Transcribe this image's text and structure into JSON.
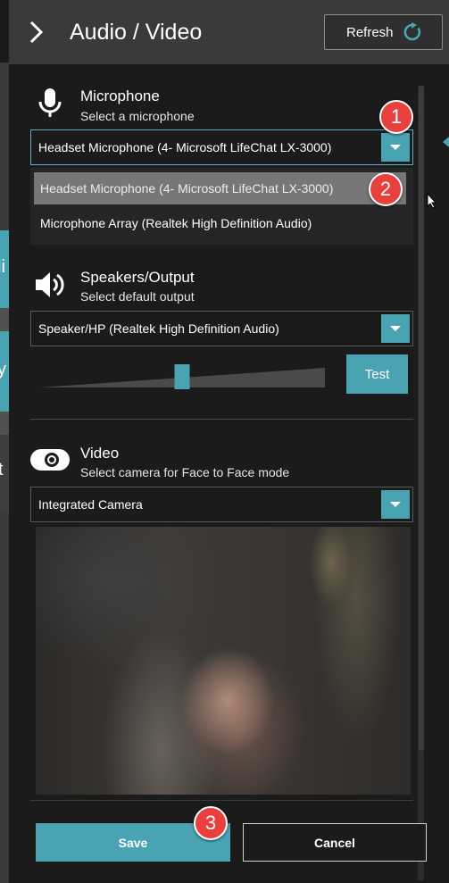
{
  "header": {
    "title": "Audio / Video",
    "refresh_label": "Refresh"
  },
  "background": {
    "tab_chars": [
      "li",
      "y",
      "t"
    ]
  },
  "microphone": {
    "title": "Microphone",
    "subtitle": "Select a microphone",
    "selected": "Headset Microphone (4- Microsoft LifeChat LX-3000)",
    "options": [
      "Headset Microphone (4- Microsoft LifeChat LX-3000)",
      "Microphone Array (Realtek High Definition Audio)"
    ]
  },
  "speakers": {
    "title": "Speakers/Output",
    "subtitle": "Select default output",
    "selected": "Speaker/HP (Realtek High Definition Audio)",
    "volume_percent": 50,
    "test_label": "Test"
  },
  "video": {
    "title": "Video",
    "subtitle": "Select camera for Face to Face mode",
    "selected": "Integrated Camera"
  },
  "footer": {
    "save_label": "Save",
    "cancel_label": "Cancel"
  },
  "annotations": {
    "badge1": "1",
    "badge2": "2",
    "badge3": "3"
  },
  "colors": {
    "accent": "#4aa3b3",
    "badge": "#e8403c",
    "panel_bg": "#1b1b1b",
    "header_bg": "#3a3a3a"
  },
  "icons": {
    "back": "chevron-right-icon",
    "refresh": "refresh-icon",
    "microphone": "microphone-icon",
    "speaker": "speaker-icon",
    "camera": "webcam-icon",
    "dropdown": "dropdown-arrow-icon"
  }
}
